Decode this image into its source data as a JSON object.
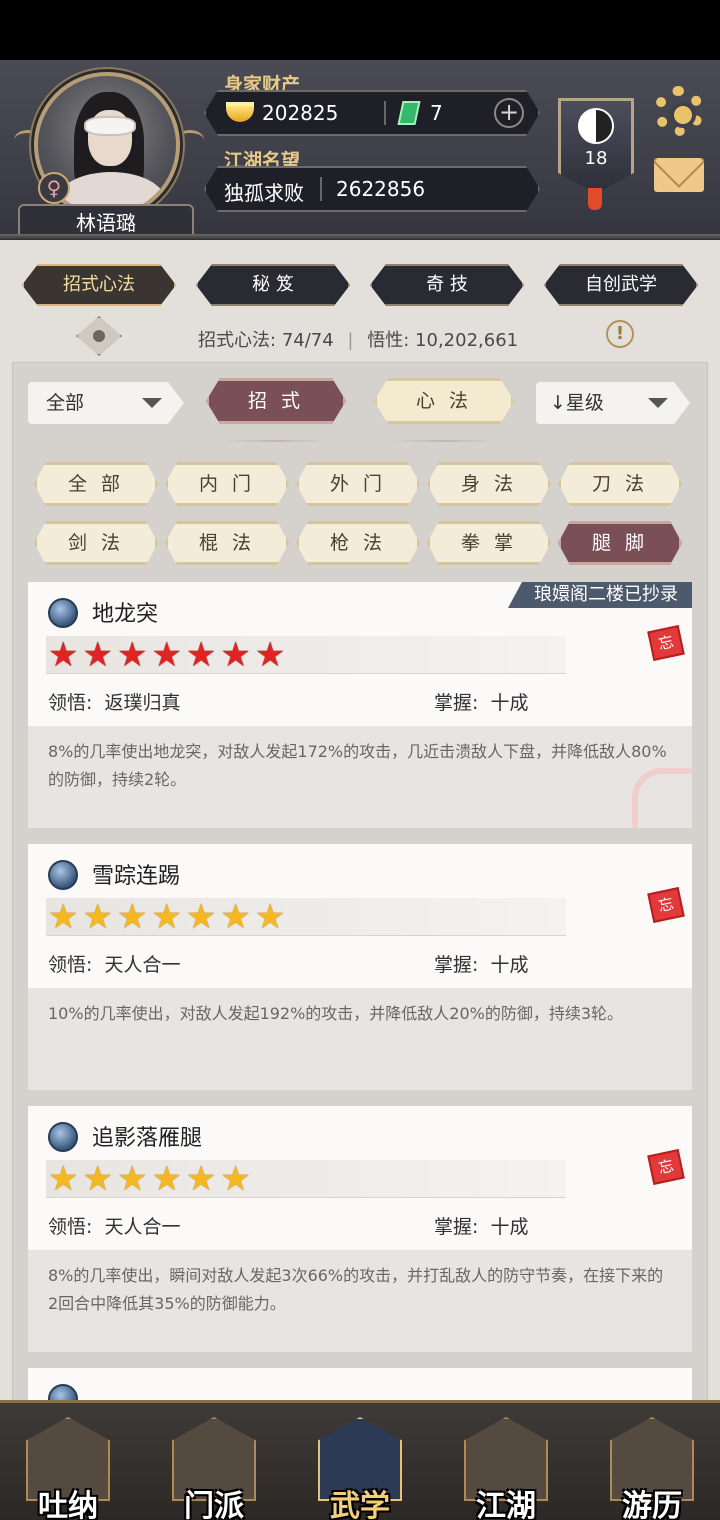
{
  "header": {
    "player_name": "林语璐",
    "gender_symbol": "♀",
    "wealth_label": "身家财产",
    "gold": "202825",
    "jade": "7",
    "plus_symbol": "+",
    "fame_label": "江湖名望",
    "fame_title": "独孤求败",
    "fame_value": "2622856",
    "level": "18"
  },
  "tabs": [
    {
      "label": "招式心法",
      "active": true
    },
    {
      "label": "秘 笈",
      "active": false
    },
    {
      "label": "奇 技",
      "active": false
    },
    {
      "label": "自创武学",
      "active": false
    }
  ],
  "stats": {
    "moves_label": "招式心法:",
    "moves_value": "74/74",
    "insight_label": "悟性:",
    "insight_value": "10,202,661",
    "info_symbol": "!"
  },
  "filters": {
    "category_select": "全部",
    "segment_moves": "招 式",
    "segment_heart": "心 法",
    "sort_select": "↓星级"
  },
  "chips": [
    "全 部",
    "内 门",
    "外 门",
    "身 法",
    "刀 法",
    "剑 法",
    "棍 法",
    "枪 法",
    "拳 掌",
    "腿 脚"
  ],
  "active_chip": "腿 脚",
  "cards": [
    {
      "name": "地龙突",
      "stars": "★★★★★★★",
      "star_color": "red",
      "ribbon": "琅嬛阁二楼已抄录",
      "insight_label": "领悟:",
      "insight": "返璞归真",
      "mastery_label": "掌握:",
      "mastery": "十成",
      "desc": "8%的几率使出地龙突，对敌人发起172%的攻击，几近击溃敌人下盘，并降低敌人80%的防御，持续2轮。",
      "seal": "忘"
    },
    {
      "name": "雪踪连踢",
      "stars": "★★★★★★★",
      "star_color": "gold",
      "insight_label": "领悟:",
      "insight": "天人合一",
      "mastery_label": "掌握:",
      "mastery": "十成",
      "desc": "10%的几率使出，对敌人发起192%的攻击，并降低敌人20%的防御，持续3轮。",
      "seal": "忘"
    },
    {
      "name": "追影落雁腿",
      "stars": "★★★★★★",
      "star_color": "gold",
      "insight_label": "领悟:",
      "insight": "天人合一",
      "mastery_label": "掌握:",
      "mastery": "十成",
      "desc": "8%的几率使出，瞬间对敌人发起3次66%的攻击，并打乱敌人的防守节奏，在接下来的2回合中降低其35%的防御能力。",
      "seal": "忘"
    }
  ],
  "bottom_nav": [
    {
      "label": "吐纳",
      "active": false
    },
    {
      "label": "门派",
      "active": false
    },
    {
      "label": "武学",
      "active": true
    },
    {
      "label": "江湖",
      "active": false
    },
    {
      "label": "游历",
      "active": false
    }
  ]
}
